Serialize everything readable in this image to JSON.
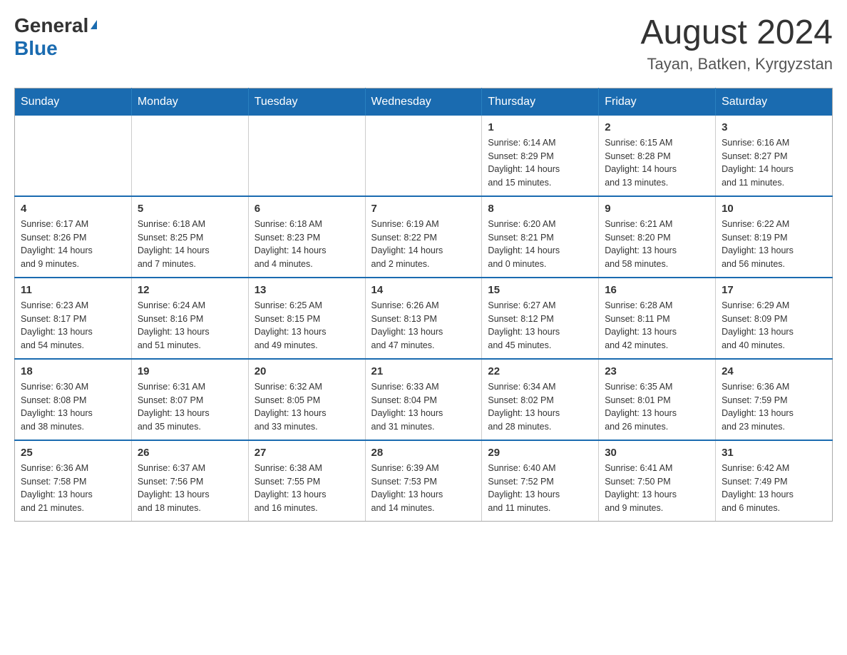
{
  "header": {
    "logo_general": "General",
    "logo_blue": "Blue",
    "month_title": "August 2024",
    "location": "Tayan, Batken, Kyrgyzstan"
  },
  "weekdays": [
    "Sunday",
    "Monday",
    "Tuesday",
    "Wednesday",
    "Thursday",
    "Friday",
    "Saturday"
  ],
  "weeks": [
    [
      {
        "day": "",
        "info": ""
      },
      {
        "day": "",
        "info": ""
      },
      {
        "day": "",
        "info": ""
      },
      {
        "day": "",
        "info": ""
      },
      {
        "day": "1",
        "info": "Sunrise: 6:14 AM\nSunset: 8:29 PM\nDaylight: 14 hours\nand 15 minutes."
      },
      {
        "day": "2",
        "info": "Sunrise: 6:15 AM\nSunset: 8:28 PM\nDaylight: 14 hours\nand 13 minutes."
      },
      {
        "day": "3",
        "info": "Sunrise: 6:16 AM\nSunset: 8:27 PM\nDaylight: 14 hours\nand 11 minutes."
      }
    ],
    [
      {
        "day": "4",
        "info": "Sunrise: 6:17 AM\nSunset: 8:26 PM\nDaylight: 14 hours\nand 9 minutes."
      },
      {
        "day": "5",
        "info": "Sunrise: 6:18 AM\nSunset: 8:25 PM\nDaylight: 14 hours\nand 7 minutes."
      },
      {
        "day": "6",
        "info": "Sunrise: 6:18 AM\nSunset: 8:23 PM\nDaylight: 14 hours\nand 4 minutes."
      },
      {
        "day": "7",
        "info": "Sunrise: 6:19 AM\nSunset: 8:22 PM\nDaylight: 14 hours\nand 2 minutes."
      },
      {
        "day": "8",
        "info": "Sunrise: 6:20 AM\nSunset: 8:21 PM\nDaylight: 14 hours\nand 0 minutes."
      },
      {
        "day": "9",
        "info": "Sunrise: 6:21 AM\nSunset: 8:20 PM\nDaylight: 13 hours\nand 58 minutes."
      },
      {
        "day": "10",
        "info": "Sunrise: 6:22 AM\nSunset: 8:19 PM\nDaylight: 13 hours\nand 56 minutes."
      }
    ],
    [
      {
        "day": "11",
        "info": "Sunrise: 6:23 AM\nSunset: 8:17 PM\nDaylight: 13 hours\nand 54 minutes."
      },
      {
        "day": "12",
        "info": "Sunrise: 6:24 AM\nSunset: 8:16 PM\nDaylight: 13 hours\nand 51 minutes."
      },
      {
        "day": "13",
        "info": "Sunrise: 6:25 AM\nSunset: 8:15 PM\nDaylight: 13 hours\nand 49 minutes."
      },
      {
        "day": "14",
        "info": "Sunrise: 6:26 AM\nSunset: 8:13 PM\nDaylight: 13 hours\nand 47 minutes."
      },
      {
        "day": "15",
        "info": "Sunrise: 6:27 AM\nSunset: 8:12 PM\nDaylight: 13 hours\nand 45 minutes."
      },
      {
        "day": "16",
        "info": "Sunrise: 6:28 AM\nSunset: 8:11 PM\nDaylight: 13 hours\nand 42 minutes."
      },
      {
        "day": "17",
        "info": "Sunrise: 6:29 AM\nSunset: 8:09 PM\nDaylight: 13 hours\nand 40 minutes."
      }
    ],
    [
      {
        "day": "18",
        "info": "Sunrise: 6:30 AM\nSunset: 8:08 PM\nDaylight: 13 hours\nand 38 minutes."
      },
      {
        "day": "19",
        "info": "Sunrise: 6:31 AM\nSunset: 8:07 PM\nDaylight: 13 hours\nand 35 minutes."
      },
      {
        "day": "20",
        "info": "Sunrise: 6:32 AM\nSunset: 8:05 PM\nDaylight: 13 hours\nand 33 minutes."
      },
      {
        "day": "21",
        "info": "Sunrise: 6:33 AM\nSunset: 8:04 PM\nDaylight: 13 hours\nand 31 minutes."
      },
      {
        "day": "22",
        "info": "Sunrise: 6:34 AM\nSunset: 8:02 PM\nDaylight: 13 hours\nand 28 minutes."
      },
      {
        "day": "23",
        "info": "Sunrise: 6:35 AM\nSunset: 8:01 PM\nDaylight: 13 hours\nand 26 minutes."
      },
      {
        "day": "24",
        "info": "Sunrise: 6:36 AM\nSunset: 7:59 PM\nDaylight: 13 hours\nand 23 minutes."
      }
    ],
    [
      {
        "day": "25",
        "info": "Sunrise: 6:36 AM\nSunset: 7:58 PM\nDaylight: 13 hours\nand 21 minutes."
      },
      {
        "day": "26",
        "info": "Sunrise: 6:37 AM\nSunset: 7:56 PM\nDaylight: 13 hours\nand 18 minutes."
      },
      {
        "day": "27",
        "info": "Sunrise: 6:38 AM\nSunset: 7:55 PM\nDaylight: 13 hours\nand 16 minutes."
      },
      {
        "day": "28",
        "info": "Sunrise: 6:39 AM\nSunset: 7:53 PM\nDaylight: 13 hours\nand 14 minutes."
      },
      {
        "day": "29",
        "info": "Sunrise: 6:40 AM\nSunset: 7:52 PM\nDaylight: 13 hours\nand 11 minutes."
      },
      {
        "day": "30",
        "info": "Sunrise: 6:41 AM\nSunset: 7:50 PM\nDaylight: 13 hours\nand 9 minutes."
      },
      {
        "day": "31",
        "info": "Sunrise: 6:42 AM\nSunset: 7:49 PM\nDaylight: 13 hours\nand 6 minutes."
      }
    ]
  ]
}
